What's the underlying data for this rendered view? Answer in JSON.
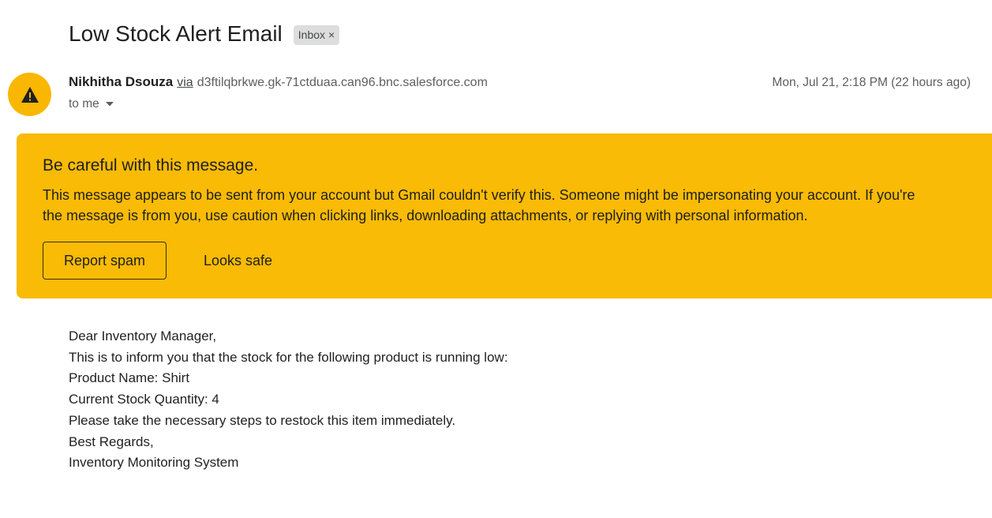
{
  "email": {
    "subject": "Low Stock Alert Email",
    "label": "Inbox",
    "label_remove_glyph": "×",
    "sender_name": "Nikhitha Dsouza",
    "via_word": "via",
    "via_domain": "d3ftilqbrkwe.gk-71ctduaa.can96.bnc.salesforce.com",
    "timestamp": "Mon, Jul 21, 2:18 PM (22 hours ago)",
    "recipient": "to me"
  },
  "avatar": {
    "icon": "warning-icon",
    "color": "#f9b701"
  },
  "warning": {
    "title": "Be careful with this message.",
    "body_lines": [
      "This message appears to be sent from your account but Gmail couldn't verify this. Someone might be impersonating your account. If you're",
      "the message is from you, use caution when clicking links, downloading attachments, or replying with personal information."
    ],
    "report_spam_label": "Report spam",
    "looks_safe_label": "Looks safe",
    "background_color": "#f9bb05"
  },
  "body": {
    "lines": [
      "Dear Inventory Manager,",
      "This is to inform you that the stock for the following product is running low:",
      "Product Name: Shirt",
      "Current Stock Quantity: 4",
      "Please take the necessary steps to restock this item immediately.",
      "Best Regards,",
      "Inventory Monitoring System"
    ]
  }
}
